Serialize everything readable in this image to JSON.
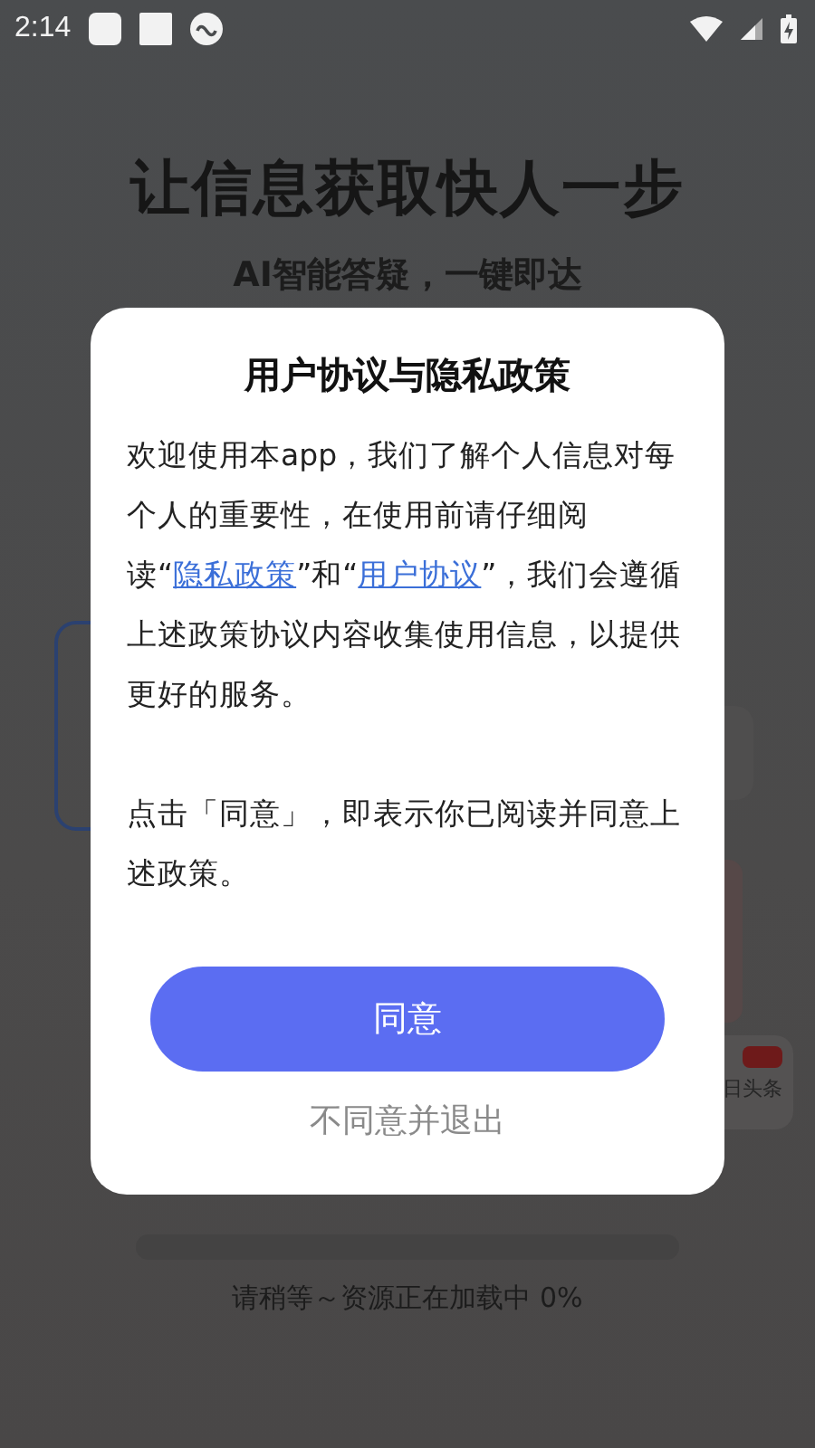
{
  "status_bar": {
    "time": "2:14"
  },
  "hero": {
    "title": "让信息获取快人一步",
    "subtitle": "AI智能答疑，一键即达"
  },
  "background_cards": [
    {
      "kind": "outline"
    },
    {
      "kind": "plain"
    },
    {
      "kind": "tinted"
    },
    {
      "kind": "news",
      "caption": "日头条"
    }
  ],
  "dialog": {
    "title": "用户协议与隐私政策",
    "paragraphs": [
      [
        {
          "kind": "text",
          "text": "欢迎使用本app，我们了解个人信息对每个人的重要性，在使用前请仔细阅读“"
        },
        {
          "kind": "link",
          "text": "隐私政策"
        },
        {
          "kind": "text",
          "text": "”和“"
        },
        {
          "kind": "link",
          "text": "用户协议"
        },
        {
          "kind": "text",
          "text": "”，我们会遵循上述政策协议内容收集使用信息，以提供更好的服务。"
        }
      ],
      [
        {
          "kind": "text",
          "text": "点击「同意」，即表示你已阅读并同意上述政策。"
        }
      ]
    ],
    "agree_button": "同意",
    "decline_link": "不同意并退出"
  },
  "loading": {
    "level": 0,
    "text": "请稍等～资源正在加载中 0%"
  }
}
